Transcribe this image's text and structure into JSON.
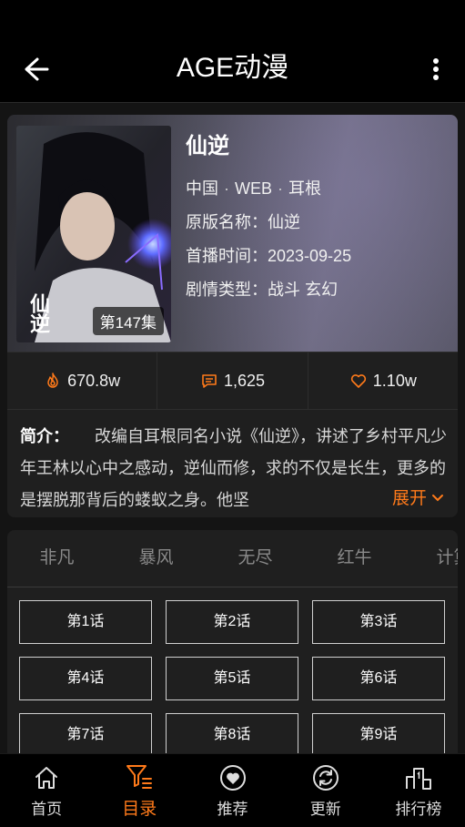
{
  "appbar": {
    "title": "AGE动漫",
    "back_icon": "arrow-left-icon",
    "more_icon": "more-vert-icon"
  },
  "anime": {
    "title": "仙逆",
    "tags": [
      "中国",
      "WEB",
      "耳根"
    ],
    "original_name_label": "原版名称：",
    "original_name": "仙逆",
    "air_date_label": "首播时间：",
    "air_date": "2023-09-25",
    "genre_label": "剧情类型：",
    "genres": "战斗 玄幻",
    "episode_badge": "第147集",
    "cover_text": "仙逆"
  },
  "stats": {
    "views": "670.8w",
    "comments": "1,625",
    "likes": "1.10w"
  },
  "intro": {
    "label": "简介：",
    "text": "改编自耳根同名小说《仙逆》，讲述了乡村平凡少年王林以心中之感动，逆仙而修，求的不仅是长生，更多的是摆脱那背后的蝼蚁之身。他坚",
    "expand_label": "展开"
  },
  "sources": [
    "非凡",
    "暴风",
    "无尽",
    "红牛",
    "计算"
  ],
  "episodes": [
    "第1话",
    "第2话",
    "第3话",
    "第4话",
    "第5话",
    "第6话",
    "第7话",
    "第8话",
    "第9话"
  ],
  "nav": [
    {
      "label": "首页",
      "icon": "home-icon"
    },
    {
      "label": "目录",
      "icon": "filter-list-icon"
    },
    {
      "label": "推荐",
      "icon": "heart-circle-icon"
    },
    {
      "label": "更新",
      "icon": "refresh-icon"
    },
    {
      "label": "排行榜",
      "icon": "podium-icon"
    }
  ],
  "colors": {
    "accent": "#ff7a1a",
    "background": "#141414",
    "card": "#1f1f1f"
  }
}
